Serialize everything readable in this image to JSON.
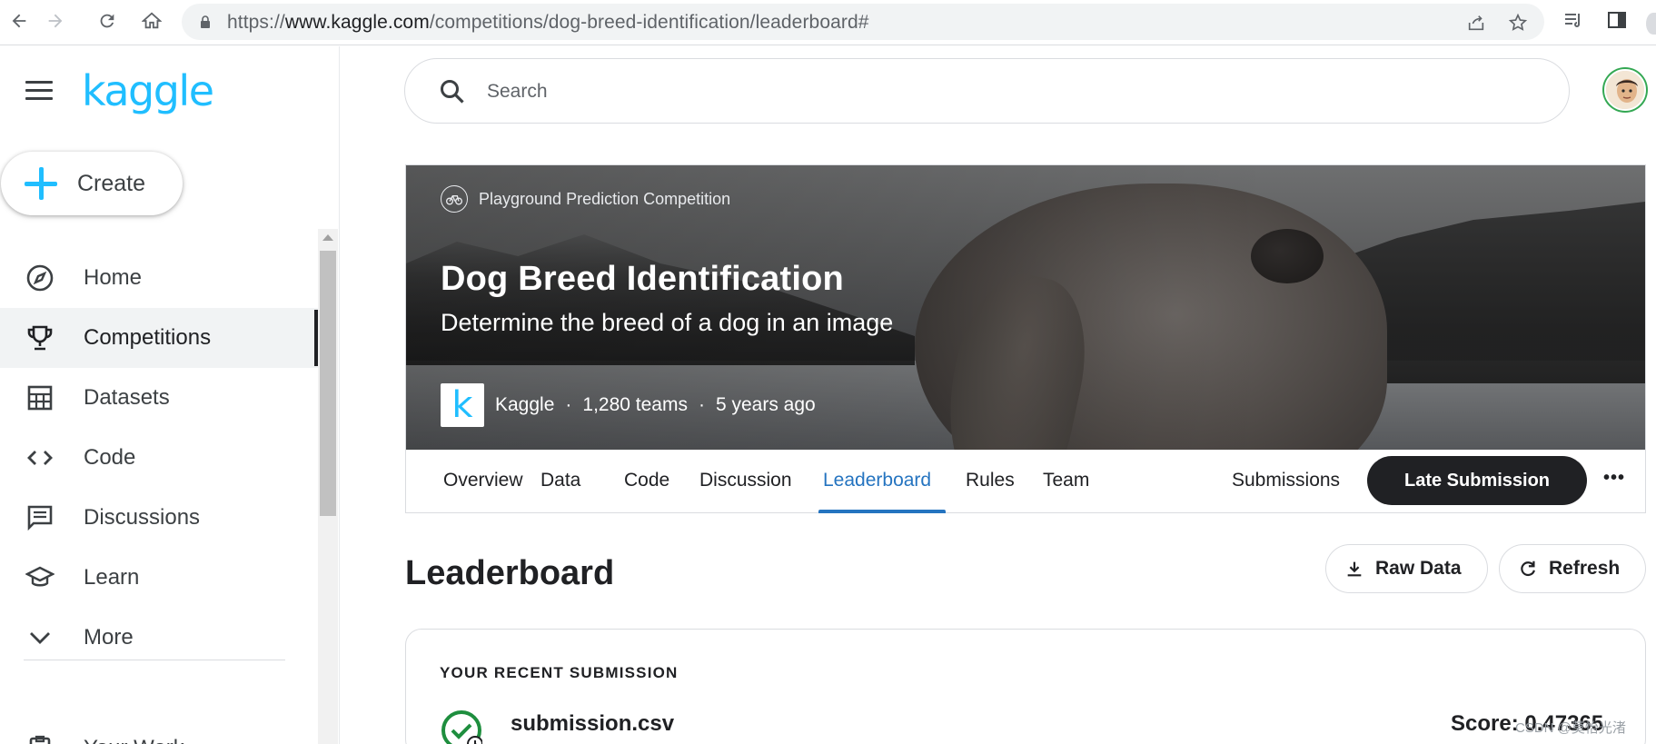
{
  "browser": {
    "url_prefix": "https://",
    "url_host": "www.kaggle.com",
    "url_path": "/competitions/dog-breed-identification/leaderboard#"
  },
  "sidebar": {
    "logo": "kaggle",
    "create_label": "Create",
    "items": [
      {
        "label": "Home",
        "icon": "compass-icon"
      },
      {
        "label": "Competitions",
        "icon": "trophy-icon",
        "active": true
      },
      {
        "label": "Datasets",
        "icon": "table-icon"
      },
      {
        "label": "Code",
        "icon": "code-icon"
      },
      {
        "label": "Discussions",
        "icon": "comment-icon"
      },
      {
        "label": "Learn",
        "icon": "graduation-cap-icon"
      },
      {
        "label": "More",
        "icon": "chevron-down-icon"
      }
    ],
    "your_work": "Your Work"
  },
  "search": {
    "placeholder": "Search"
  },
  "competition": {
    "type": "Playground Prediction Competition",
    "title": "Dog Breed Identification",
    "subtitle": "Determine the breed of a dog in an image",
    "host_logo_letter": "k",
    "host": "Kaggle",
    "teams": "1,280 teams",
    "age": "5 years ago",
    "separator": "·"
  },
  "tabs": {
    "items": [
      "Overview",
      "Data",
      "Code",
      "Discussion",
      "Leaderboard",
      "Rules",
      "Team"
    ],
    "active": "Leaderboard",
    "submissions": "Submissions",
    "late_submission": "Late Submission",
    "more": "•••"
  },
  "leaderboard": {
    "title": "Leaderboard",
    "raw_data": "Raw Data",
    "refresh": "Refresh"
  },
  "recent": {
    "heading": "YOUR RECENT SUBMISSION",
    "filename": "submission.csv",
    "score": "Score: 0.47365"
  },
  "watermark": "CSDN @莫怡光渚",
  "colors": {
    "brand": "#20beff",
    "active_tab": "#2574c0",
    "primary_button": "#202124",
    "success": "#1e8e3e"
  }
}
